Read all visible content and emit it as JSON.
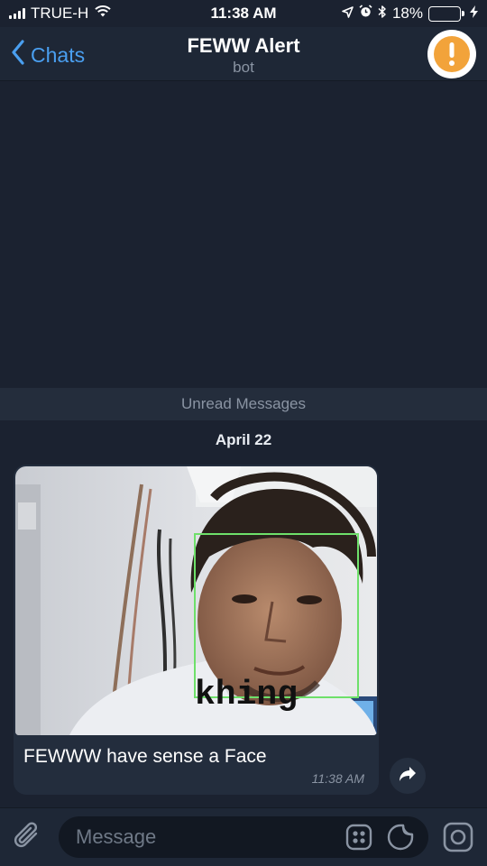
{
  "status_bar": {
    "carrier": "TRUE-H",
    "time": "11:38 AM",
    "battery_percent": "18%",
    "battery_level": 0.18,
    "battery_color": "#f5c53d",
    "icons": [
      "signal-bars-icon",
      "wifi-icon",
      "location-arrow-icon",
      "alarm-icon",
      "bluetooth-icon",
      "battery-icon",
      "charging-bolt-icon"
    ]
  },
  "nav": {
    "back_label": "Chats",
    "title": "FEWW Alert",
    "subtitle": "bot",
    "accent_color": "#4a9ff0",
    "avatar_icon": "exclamation-icon",
    "avatar_color": "#f2a33a"
  },
  "chat": {
    "unread_label": "Unread Messages",
    "date_label": "April 22",
    "message": {
      "photo_overlay_label": "khing",
      "caption": "FEWWW have sense a Face",
      "time": "11:38 AM"
    }
  },
  "input": {
    "placeholder": "Message",
    "icons": [
      "paperclip-icon",
      "commands-grid-icon",
      "sticker-icon",
      "camera-icon"
    ]
  }
}
